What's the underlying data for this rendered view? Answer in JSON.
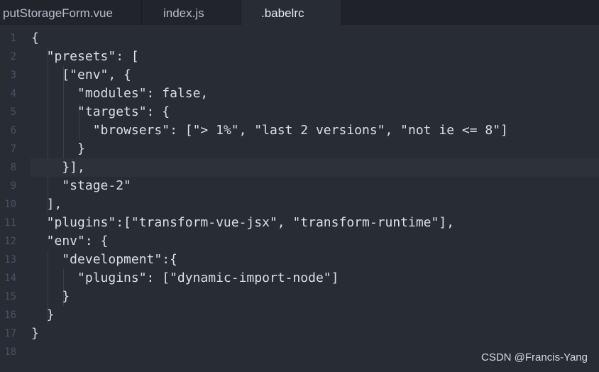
{
  "tabs": [
    {
      "label": "putStorageForm.vue",
      "active": false
    },
    {
      "label": "index.js",
      "active": false
    },
    {
      "label": ".babelrc",
      "active": true
    }
  ],
  "editor": {
    "current_line": 8,
    "lines": [
      {
        "number": "1",
        "text": "{"
      },
      {
        "number": "2",
        "text": "  \"presets\": ["
      },
      {
        "number": "3",
        "text": "    [\"env\", {"
      },
      {
        "number": "4",
        "text": "      \"modules\": false,"
      },
      {
        "number": "5",
        "text": "      \"targets\": {"
      },
      {
        "number": "6",
        "text": "        \"browsers\": [\"> 1%\", \"last 2 versions\", \"not ie <= 8\"]"
      },
      {
        "number": "7",
        "text": "      }"
      },
      {
        "number": "8",
        "text": "    }],"
      },
      {
        "number": "9",
        "text": "    \"stage-2\""
      },
      {
        "number": "10",
        "text": "  ],"
      },
      {
        "number": "11",
        "text": "  \"plugins\":[\"transform-vue-jsx\", \"transform-runtime\"],"
      },
      {
        "number": "12",
        "text": "  \"env\": {"
      },
      {
        "number": "13",
        "text": "    \"development\":{"
      },
      {
        "number": "14",
        "text": "      \"plugins\": [\"dynamic-import-node\"]"
      },
      {
        "number": "15",
        "text": "    }"
      },
      {
        "number": "16",
        "text": "  }"
      },
      {
        "number": "17",
        "text": "}"
      },
      {
        "number": "18",
        "text": ""
      }
    ]
  },
  "watermark": "CSDN @Francis-Yang",
  "colors": {
    "background": "#282c34",
    "tabbar": "#1f2329",
    "text": "#dcdfe4",
    "line_number": "#4b5263",
    "current_line": "#2c313a"
  }
}
